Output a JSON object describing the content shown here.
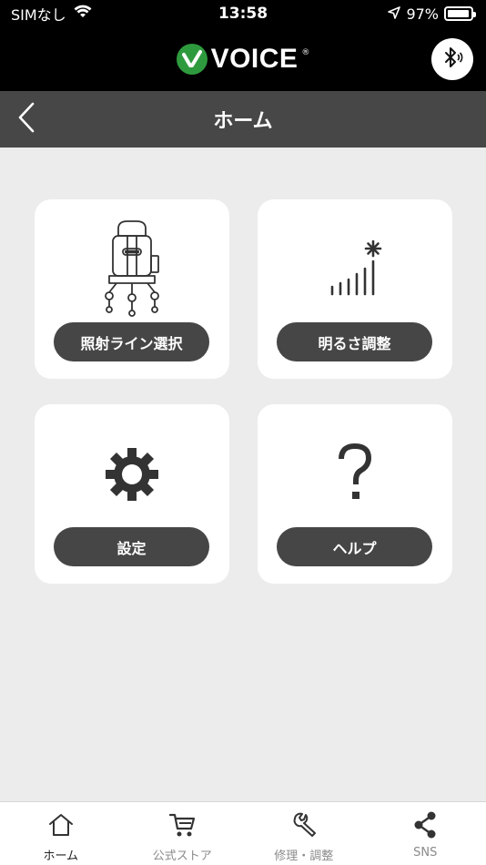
{
  "status_bar": {
    "carrier": "SIMなし",
    "time": "13:58",
    "battery": "97%",
    "battery_level": 0.97
  },
  "header": {
    "brand": "VOICE",
    "registered": "®",
    "bluetooth_icon": "bluetooth-icon"
  },
  "nav": {
    "title": "ホーム",
    "back_icon": "chevron-left-icon"
  },
  "cards": [
    {
      "label": "照射ライン選択",
      "icon": "laser-level-icon"
    },
    {
      "label": "明るさ調整",
      "icon": "brightness-signal-icon"
    },
    {
      "label": "設定",
      "icon": "gear-icon"
    },
    {
      "label": "ヘルプ",
      "icon": "question-icon"
    }
  ],
  "tabs": [
    {
      "label": "ホーム",
      "icon": "home-icon",
      "active": true
    },
    {
      "label": "公式ストア",
      "icon": "cart-icon",
      "active": false
    },
    {
      "label": "修理・調整",
      "icon": "wrench-icon",
      "active": false
    },
    {
      "label": "SNS",
      "icon": "share-icon",
      "active": false
    }
  ],
  "colors": {
    "brand_green": "#2e9a3e",
    "nav_gray": "#474747",
    "button_gray": "#464646",
    "background": "#ececec"
  }
}
